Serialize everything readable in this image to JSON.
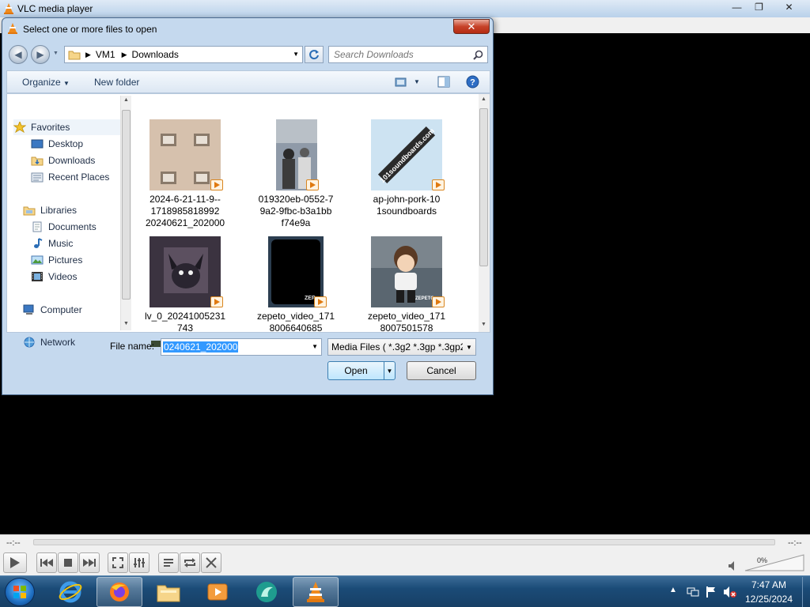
{
  "vlc": {
    "title": "VLC media player",
    "time_elapsed": "--:--",
    "time_total": "--:--",
    "volume": "0%"
  },
  "dialog": {
    "title": "Select one or more files to open",
    "path": [
      "VM1",
      "Downloads"
    ],
    "search_placeholder": "Search Downloads",
    "toolbar": {
      "organize": "Organize",
      "new_folder": "New folder"
    },
    "nav": {
      "favorites": "Favorites",
      "desktop": "Desktop",
      "downloads": "Downloads",
      "recent_places": "Recent Places",
      "libraries": "Libraries",
      "documents": "Documents",
      "music": "Music",
      "pictures": "Pictures",
      "videos": "Videos",
      "computer": "Computer",
      "network": "Network"
    },
    "files": [
      {
        "name": "2024-6-21-11-9--\n1718985818992\n20240621_202000"
      },
      {
        "name": "019320eb-0552-7\n9a2-9fbc-b3a1bb\nf74e9a"
      },
      {
        "name": "ap-john-pork-10\n1soundboards",
        "thumb_text": "101soundboards.com"
      },
      {
        "name": "lv_0_20241005231\n743"
      },
      {
        "name": "zepeto_video_171\n8006640685",
        "thumb_text": "ZEP"
      },
      {
        "name": "zepeto_video_171\n8007501578",
        "thumb_text": "ZEPETO"
      }
    ],
    "filename_label": "File name:",
    "filename_value": "0240621_202000",
    "filter": "Media Files ( *.3g2 *.3gp *.3gp2",
    "open": "Open",
    "cancel": "Cancel"
  },
  "clock": {
    "time": "7:47 AM",
    "date": "12/25/2024"
  }
}
